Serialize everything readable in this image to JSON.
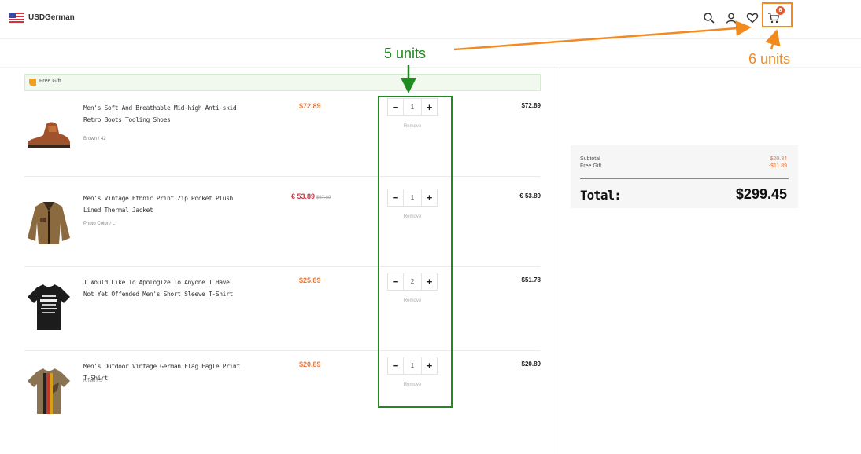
{
  "header": {
    "currency": "USD",
    "language": "German",
    "cart_badge": "6",
    "icons": [
      "search-icon",
      "user-icon",
      "heart-icon",
      "cart-icon"
    ]
  },
  "free_gift": {
    "label": "Free Gift"
  },
  "cart_items": [
    {
      "name": "Men's Soft And Breathable Mid-high Anti-skid Retro Boots Tooling Shoes",
      "variant": "Brown / 42",
      "price": "$72.89",
      "quantity": "1",
      "remove": "Remove",
      "subtotal": "$72.89",
      "image": "boots-thumbnail"
    },
    {
      "name": "Men's Vintage Ethnic Print Zip Pocket Plush Lined Thermal Jacket",
      "variant": "Photo Color / L",
      "price": "€ 53.89",
      "price_old": "$67.89",
      "quantity": "1",
      "remove": "Remove",
      "subtotal": "€ 53.89",
      "image": "jacket-thumbnail"
    },
    {
      "name": "I Would Like To Apologize To Anyone I Have Not Yet Offended Men's Short Sleeve T-Shirt",
      "variant": "",
      "price": "$25.89",
      "quantity": "2",
      "remove": "Remove",
      "subtotal": "$51.78",
      "image": "black-tshirt-thumbnail"
    },
    {
      "name": "Men's Outdoor Vintage German Flag Eagle Print T-Shirt",
      "variant": "Khaki / S",
      "price": "$20.89",
      "quantity": "1",
      "remove": "Remove",
      "subtotal": "$20.89",
      "image": "flag-tshirt-thumbnail"
    }
  ],
  "summary": {
    "subtotal_label": "Subtotal",
    "subtotal_value": "$20.34",
    "gift_label": "Free Gift",
    "gift_value": "-$11.89",
    "total_label": "Total:",
    "total_value": "$299.45"
  },
  "annotations": {
    "green_text": "5 units",
    "orange_text": "6 units",
    "green_color": "#1f8a1f",
    "orange_color": "#f28a1e"
  }
}
